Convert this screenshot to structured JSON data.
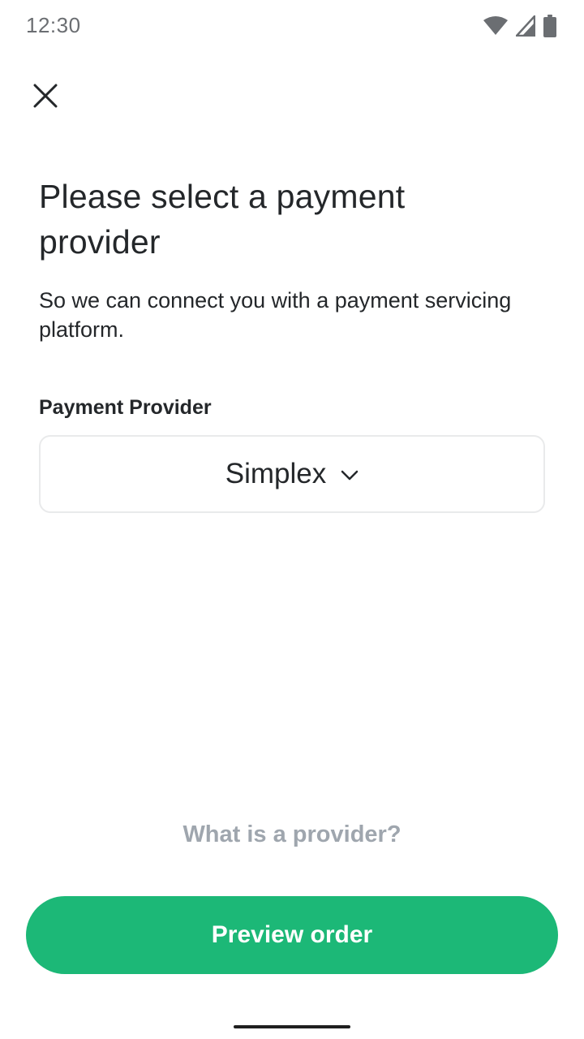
{
  "status_bar": {
    "time": "12:30",
    "icons": [
      "wifi-icon",
      "cell-signal-icon",
      "battery-icon"
    ]
  },
  "header": {
    "close_icon": "close-icon"
  },
  "main": {
    "title": "Please select a payment provider",
    "subtitle": "So we can connect you with a payment servicing platform.",
    "provider_field": {
      "label": "Payment Provider",
      "selected_value": "Simplex",
      "icon": "chevron-down-icon"
    },
    "help_link": "What is a provider?"
  },
  "footer": {
    "primary_button_label": "Preview order"
  },
  "colors": {
    "primary_green": "#1cb877",
    "text": "#24272a",
    "muted_text": "#9fa6ae",
    "border": "#e9eaeb"
  }
}
